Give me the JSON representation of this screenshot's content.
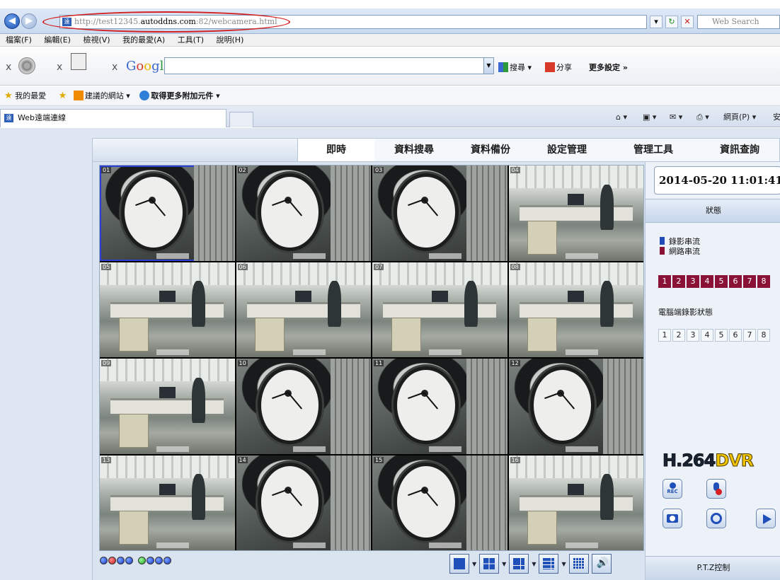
{
  "browser": {
    "url_prefix": "http://test12345.",
    "url_domain": "autoddns.com",
    "url_suffix": ":82/webcamera.html",
    "search_placeholder": "Web Search",
    "menu": [
      "檔案(F)",
      "編輯(E)",
      "檢視(V)",
      "我的最愛(A)",
      "工具(T)",
      "說明(H)"
    ],
    "google_label": "Google",
    "toolbar_items": [
      "搜尋",
      "分享",
      "更多設定 »"
    ],
    "favorites_label": "我的最愛",
    "suggested_sites": "建議的網站",
    "more_addons": "取得更多附加元件",
    "tab_title": "Web遠端連線",
    "page_menu": "網頁(P)",
    "safety_menu": "安"
  },
  "dvr": {
    "tabs": [
      "即時",
      "資料搜尋",
      "資料備份",
      "設定管理",
      "管理工具",
      "資訊查詢"
    ],
    "active_tab": 0,
    "datetime": "2014-05-20 11:01:41",
    "status_label": "狀態",
    "legend_record": "錄影串流",
    "legend_network": "網路串流",
    "channels": [
      "1",
      "2",
      "3",
      "4",
      "5",
      "6",
      "7",
      "8"
    ],
    "pc_record_label": "電腦端錄影狀態",
    "brand_h264": "H.264",
    "brand_dvr": "DVR",
    "ptz_label": "P.T.Z控制",
    "legend_colors": {
      "record": "#1e4bb8",
      "network": "#8a1236"
    },
    "cameras": [
      {
        "num": "01",
        "scene": "clock"
      },
      {
        "num": "02",
        "scene": "clock"
      },
      {
        "num": "03",
        "scene": "clock"
      },
      {
        "num": "04",
        "scene": "office"
      },
      {
        "num": "05",
        "scene": "office"
      },
      {
        "num": "06",
        "scene": "office"
      },
      {
        "num": "07",
        "scene": "office"
      },
      {
        "num": "08",
        "scene": "office"
      },
      {
        "num": "09",
        "scene": "office"
      },
      {
        "num": "10",
        "scene": "clock"
      },
      {
        "num": "11",
        "scene": "clock"
      },
      {
        "num": "12",
        "scene": "clock"
      },
      {
        "num": "13",
        "scene": "office"
      },
      {
        "num": "14",
        "scene": "clock"
      },
      {
        "num": "15",
        "scene": "clock"
      },
      {
        "num": "16",
        "scene": "office"
      }
    ],
    "selected_camera": 0
  }
}
